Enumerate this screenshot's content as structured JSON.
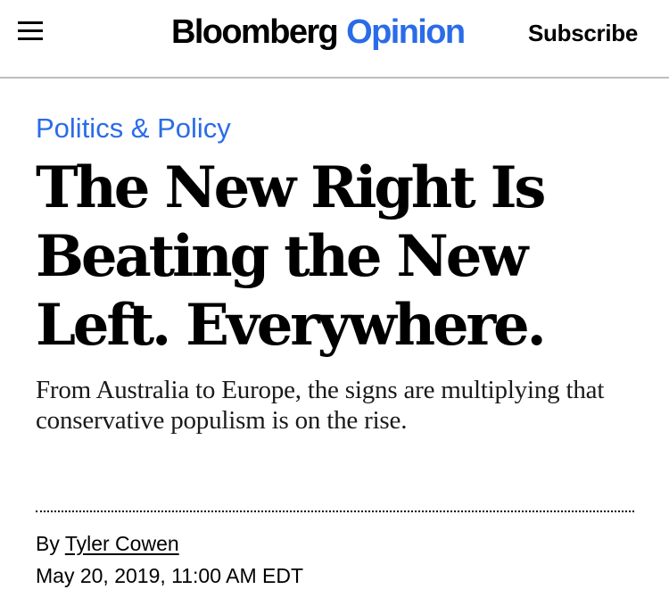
{
  "header": {
    "menu_icon": "hamburger-menu-icon",
    "logo_brand": "Bloomberg",
    "logo_section": "Opinion",
    "subscribe_label": "Subscribe"
  },
  "article": {
    "category": "Politics & Policy",
    "headline_line1": "The New Right Is",
    "headline_line2": "Beating the New",
    "headline_line3": "Left. Everywhere.",
    "dek": "From Australia to Europe, the signs are multiplying that conservative populism is on the rise.",
    "byline_prefix": "By",
    "author": "Tyler Cowen",
    "date": "May 20, 2019, 11:00 AM EDT"
  },
  "colors": {
    "accent": "#2a6ce8",
    "text": "#000000",
    "divider": "#bdbdbd"
  }
}
